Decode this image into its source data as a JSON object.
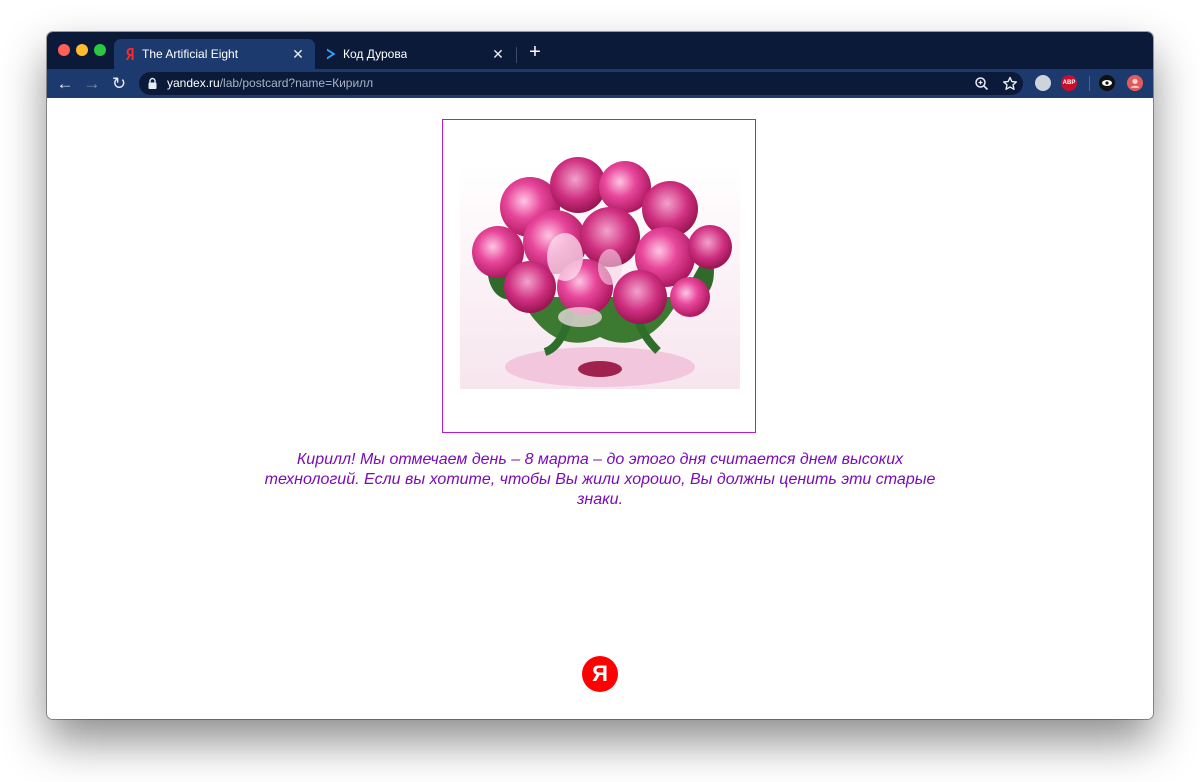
{
  "tabs": [
    {
      "title": "The Artificial Eight",
      "favicon": "yandex-ya-icon",
      "active": true
    },
    {
      "title": "Код Дурова",
      "favicon": "chevron-right-icon",
      "active": false
    }
  ],
  "tab_close_glyph": "✕",
  "new_tab_glyph": "+",
  "navigation": {
    "back_glyph": "←",
    "forward_glyph": "→",
    "reload_glyph": "↻"
  },
  "address_bar": {
    "host": "yandex.ru",
    "path": "/lab/postcard?name=Кирилл"
  },
  "extensions": {
    "abp_label": "ABP"
  },
  "postcard": {
    "image_description_icon": "flower-bouquet-icon",
    "frame_color": "#b519d6",
    "greeting": "Кирилл! Мы отмечаем день – 8 марта – до этого дня считается днем высоких технологий. Если вы хотите, чтобы Вы жили хорошо, Вы должны ценить эти старые знаки.",
    "text_color": "#7a0cb8"
  },
  "footer": {
    "logo_letter": "Я",
    "logo_color": "#ff0000"
  },
  "colors": {
    "tab_strip": "#0c1a3a",
    "toolbar": "#1d3a6e"
  }
}
